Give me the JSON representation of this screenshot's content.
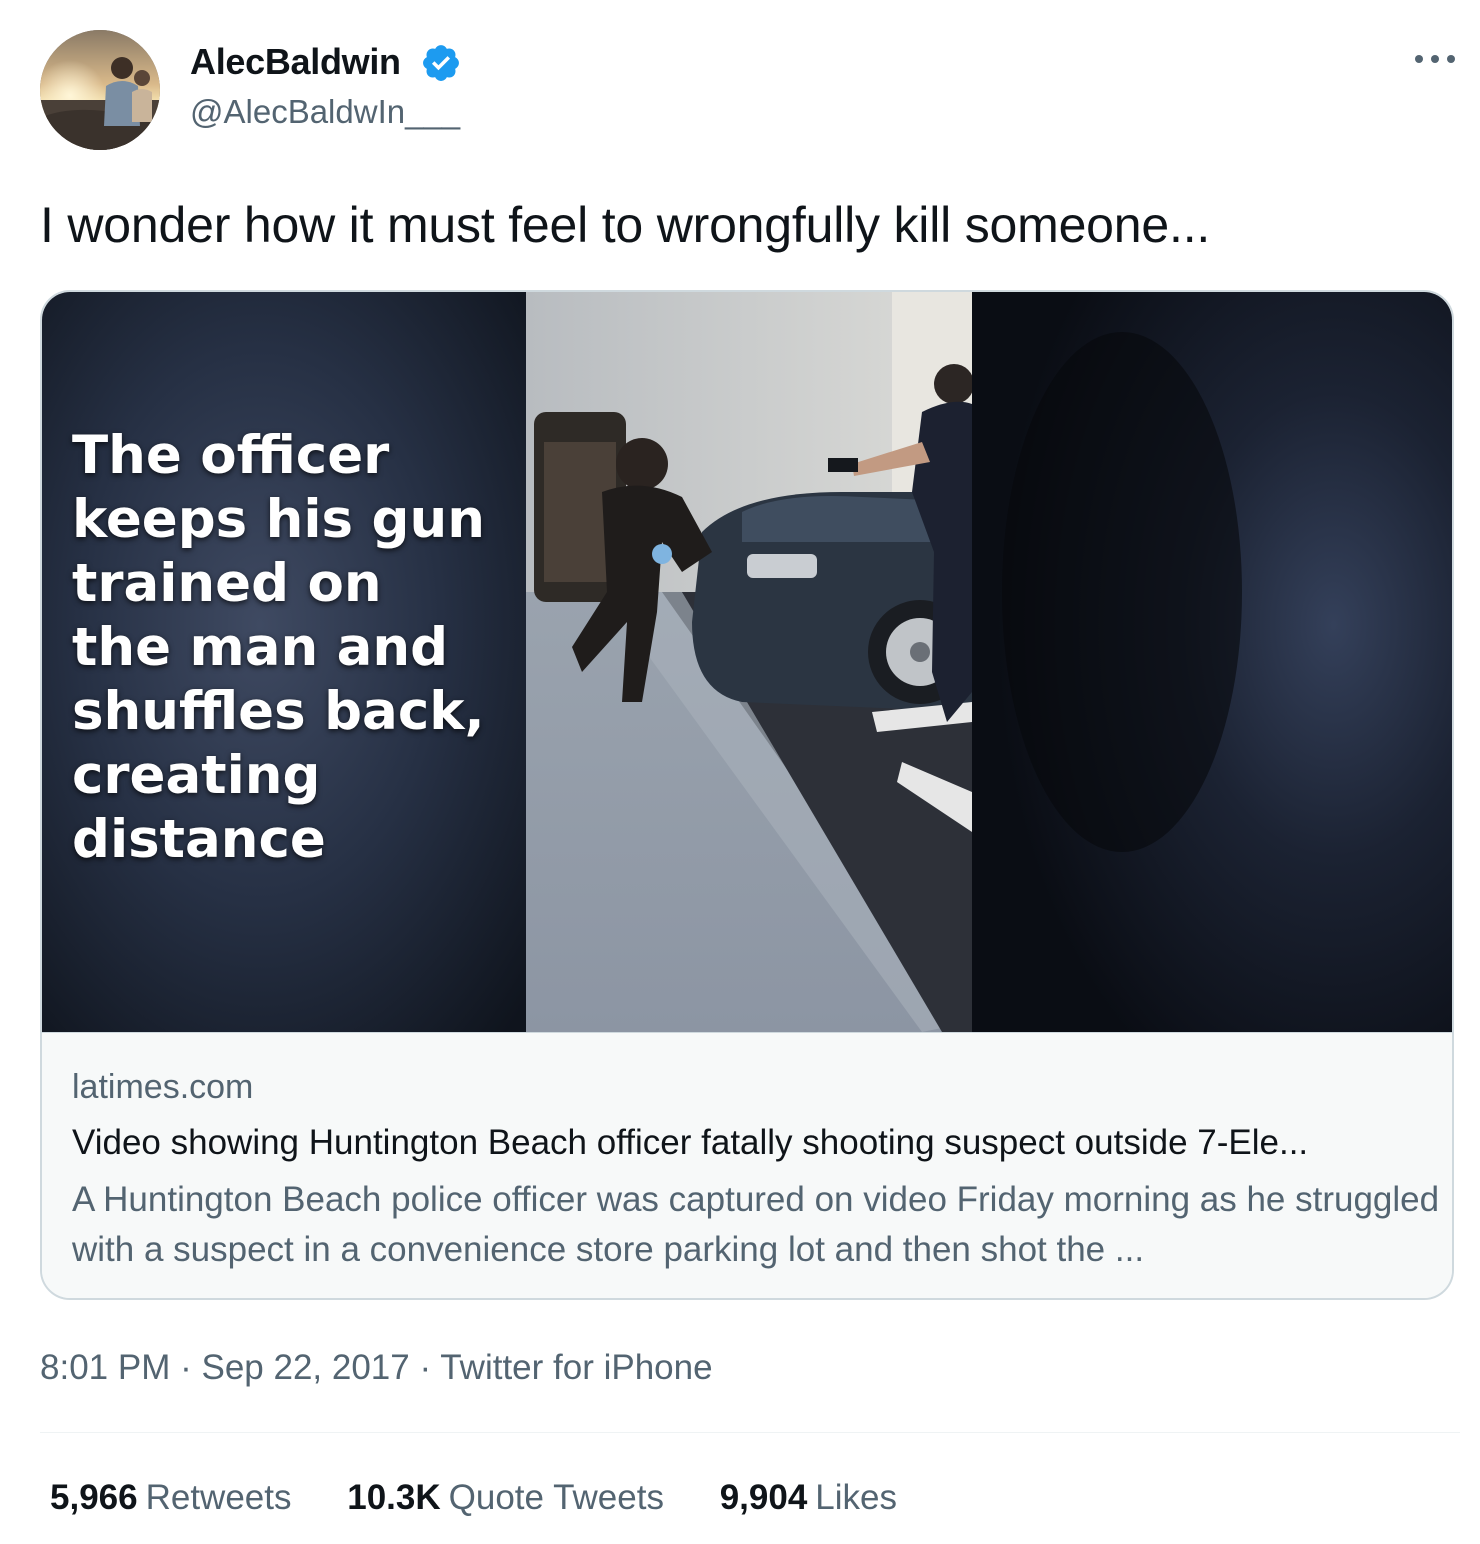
{
  "author": {
    "display_name": "AlecBaldwin",
    "handle": "@AlecBaldwIn___",
    "verified": true,
    "verified_color": "#1d9bf0"
  },
  "tweet": {
    "text": "I wonder how it must feel to wrongfully kill someone..."
  },
  "card": {
    "media_caption": "The officer\nkeeps his gun\ntrained on\nthe man and\nshuffles back,\ncreating\ndistance",
    "domain": "latimes.com",
    "title": "Video showing Huntington Beach officer fatally shooting suspect outside 7-Ele...",
    "description": "A Huntington Beach police officer was captured on video Friday morning as he struggled with a suspect in a convenience store parking lot and then shot the ..."
  },
  "meta": {
    "time": "8:01 PM",
    "separator": "·",
    "date": "Sep 22, 2017",
    "source": "Twitter for iPhone"
  },
  "stats": {
    "retweets_count": "5,966",
    "retweets_label": "Retweets",
    "quotes_count": "10.3K",
    "quotes_label": "Quote Tweets",
    "likes_count": "9,904",
    "likes_label": "Likes"
  },
  "icons": {
    "verified": "verified-badge-icon",
    "more": "more-horizontal-icon"
  },
  "colors": {
    "text_primary": "#0f1419",
    "text_secondary": "#536471",
    "border": "#cfd9de",
    "card_bg": "#f7f9f9"
  }
}
